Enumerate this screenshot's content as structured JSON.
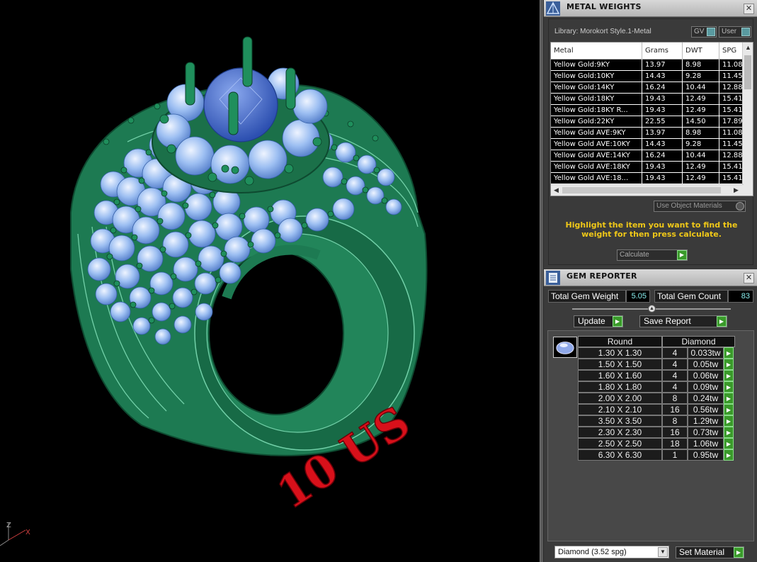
{
  "viewport": {
    "overlay_text": "10 US",
    "axis_labels": {
      "x": "X",
      "z": "Z"
    }
  },
  "metal_weights": {
    "title": "METAL WEIGHTS",
    "library": "Library: Morokort Style.1-Metal",
    "toggle_gv": "GV",
    "toggle_user": "User",
    "columns": [
      "Metal",
      "Grams",
      "DWT",
      "SPG"
    ],
    "rows": [
      [
        "Yellow Gold:9KY",
        "13.97",
        "8.98",
        "11.08"
      ],
      [
        "Yellow Gold:10KY",
        "14.43",
        "9.28",
        "11.45"
      ],
      [
        "Yellow Gold:14KY",
        "16.24",
        "10.44",
        "12.88"
      ],
      [
        "Yellow Gold:18KY",
        "19.43",
        "12.49",
        "15.41"
      ],
      [
        "Yellow Gold:18KY R...",
        "19.43",
        "12.49",
        "15.41"
      ],
      [
        "Yellow Gold:22KY",
        "22.55",
        "14.50",
        "17.89"
      ],
      [
        "Yellow Gold AVE:9KY",
        "13.97",
        "8.98",
        "11.08"
      ],
      [
        "Yellow Gold AVE:10KY",
        "14.43",
        "9.28",
        "11.45"
      ],
      [
        "Yellow Gold AVE:14KY",
        "16.24",
        "10.44",
        "12.88"
      ],
      [
        "Yellow Gold AVE:18KY",
        "19.43",
        "12.49",
        "15.41"
      ],
      [
        "Yellow Gold AVE:18...",
        "19.43",
        "12.49",
        "15.41"
      ]
    ],
    "use_object_materials": "Use Object Materials",
    "hint": "Highlight the item you want to find the weight for then press calculate.",
    "calculate": "Calculate"
  },
  "gem_reporter": {
    "title": "GEM REPORTER",
    "total_weight_label": "Total Gem Weight",
    "total_weight": "5.05",
    "total_count_label": "Total Gem Count",
    "total_count": "83",
    "update": "Update",
    "save_report": "Save Report",
    "col_shape": "Round",
    "col_material": "Diamond",
    "rows": [
      [
        "1.30 X 1.30",
        "4",
        "0.033tw"
      ],
      [
        "1.50 X 1.50",
        "4",
        "0.05tw"
      ],
      [
        "1.60 X 1.60",
        "4",
        "0.06tw"
      ],
      [
        "1.80 X 1.80",
        "4",
        "0.09tw"
      ],
      [
        "2.00 X 2.00",
        "8",
        "0.24tw"
      ],
      [
        "2.10 X 2.10",
        "16",
        "0.56tw"
      ],
      [
        "3.50 X 3.50",
        "8",
        "1.29tw"
      ],
      [
        "2.30 X 2.30",
        "16",
        "0.73tw"
      ],
      [
        "2.50 X 2.50",
        "18",
        "1.06tw"
      ],
      [
        "6.30 X 6.30",
        "1",
        "0.95tw"
      ]
    ],
    "material_select": "Diamond     (3.52 spg)",
    "set_material": "Set Material"
  },
  "colors": {
    "metal": "#1d7a52",
    "gem": "#8fb6ee",
    "center_gem": "#3c62c4",
    "overlay_text": "#d8101a",
    "hint_text": "#f0c818",
    "action_green": "#3a9a2a"
  }
}
